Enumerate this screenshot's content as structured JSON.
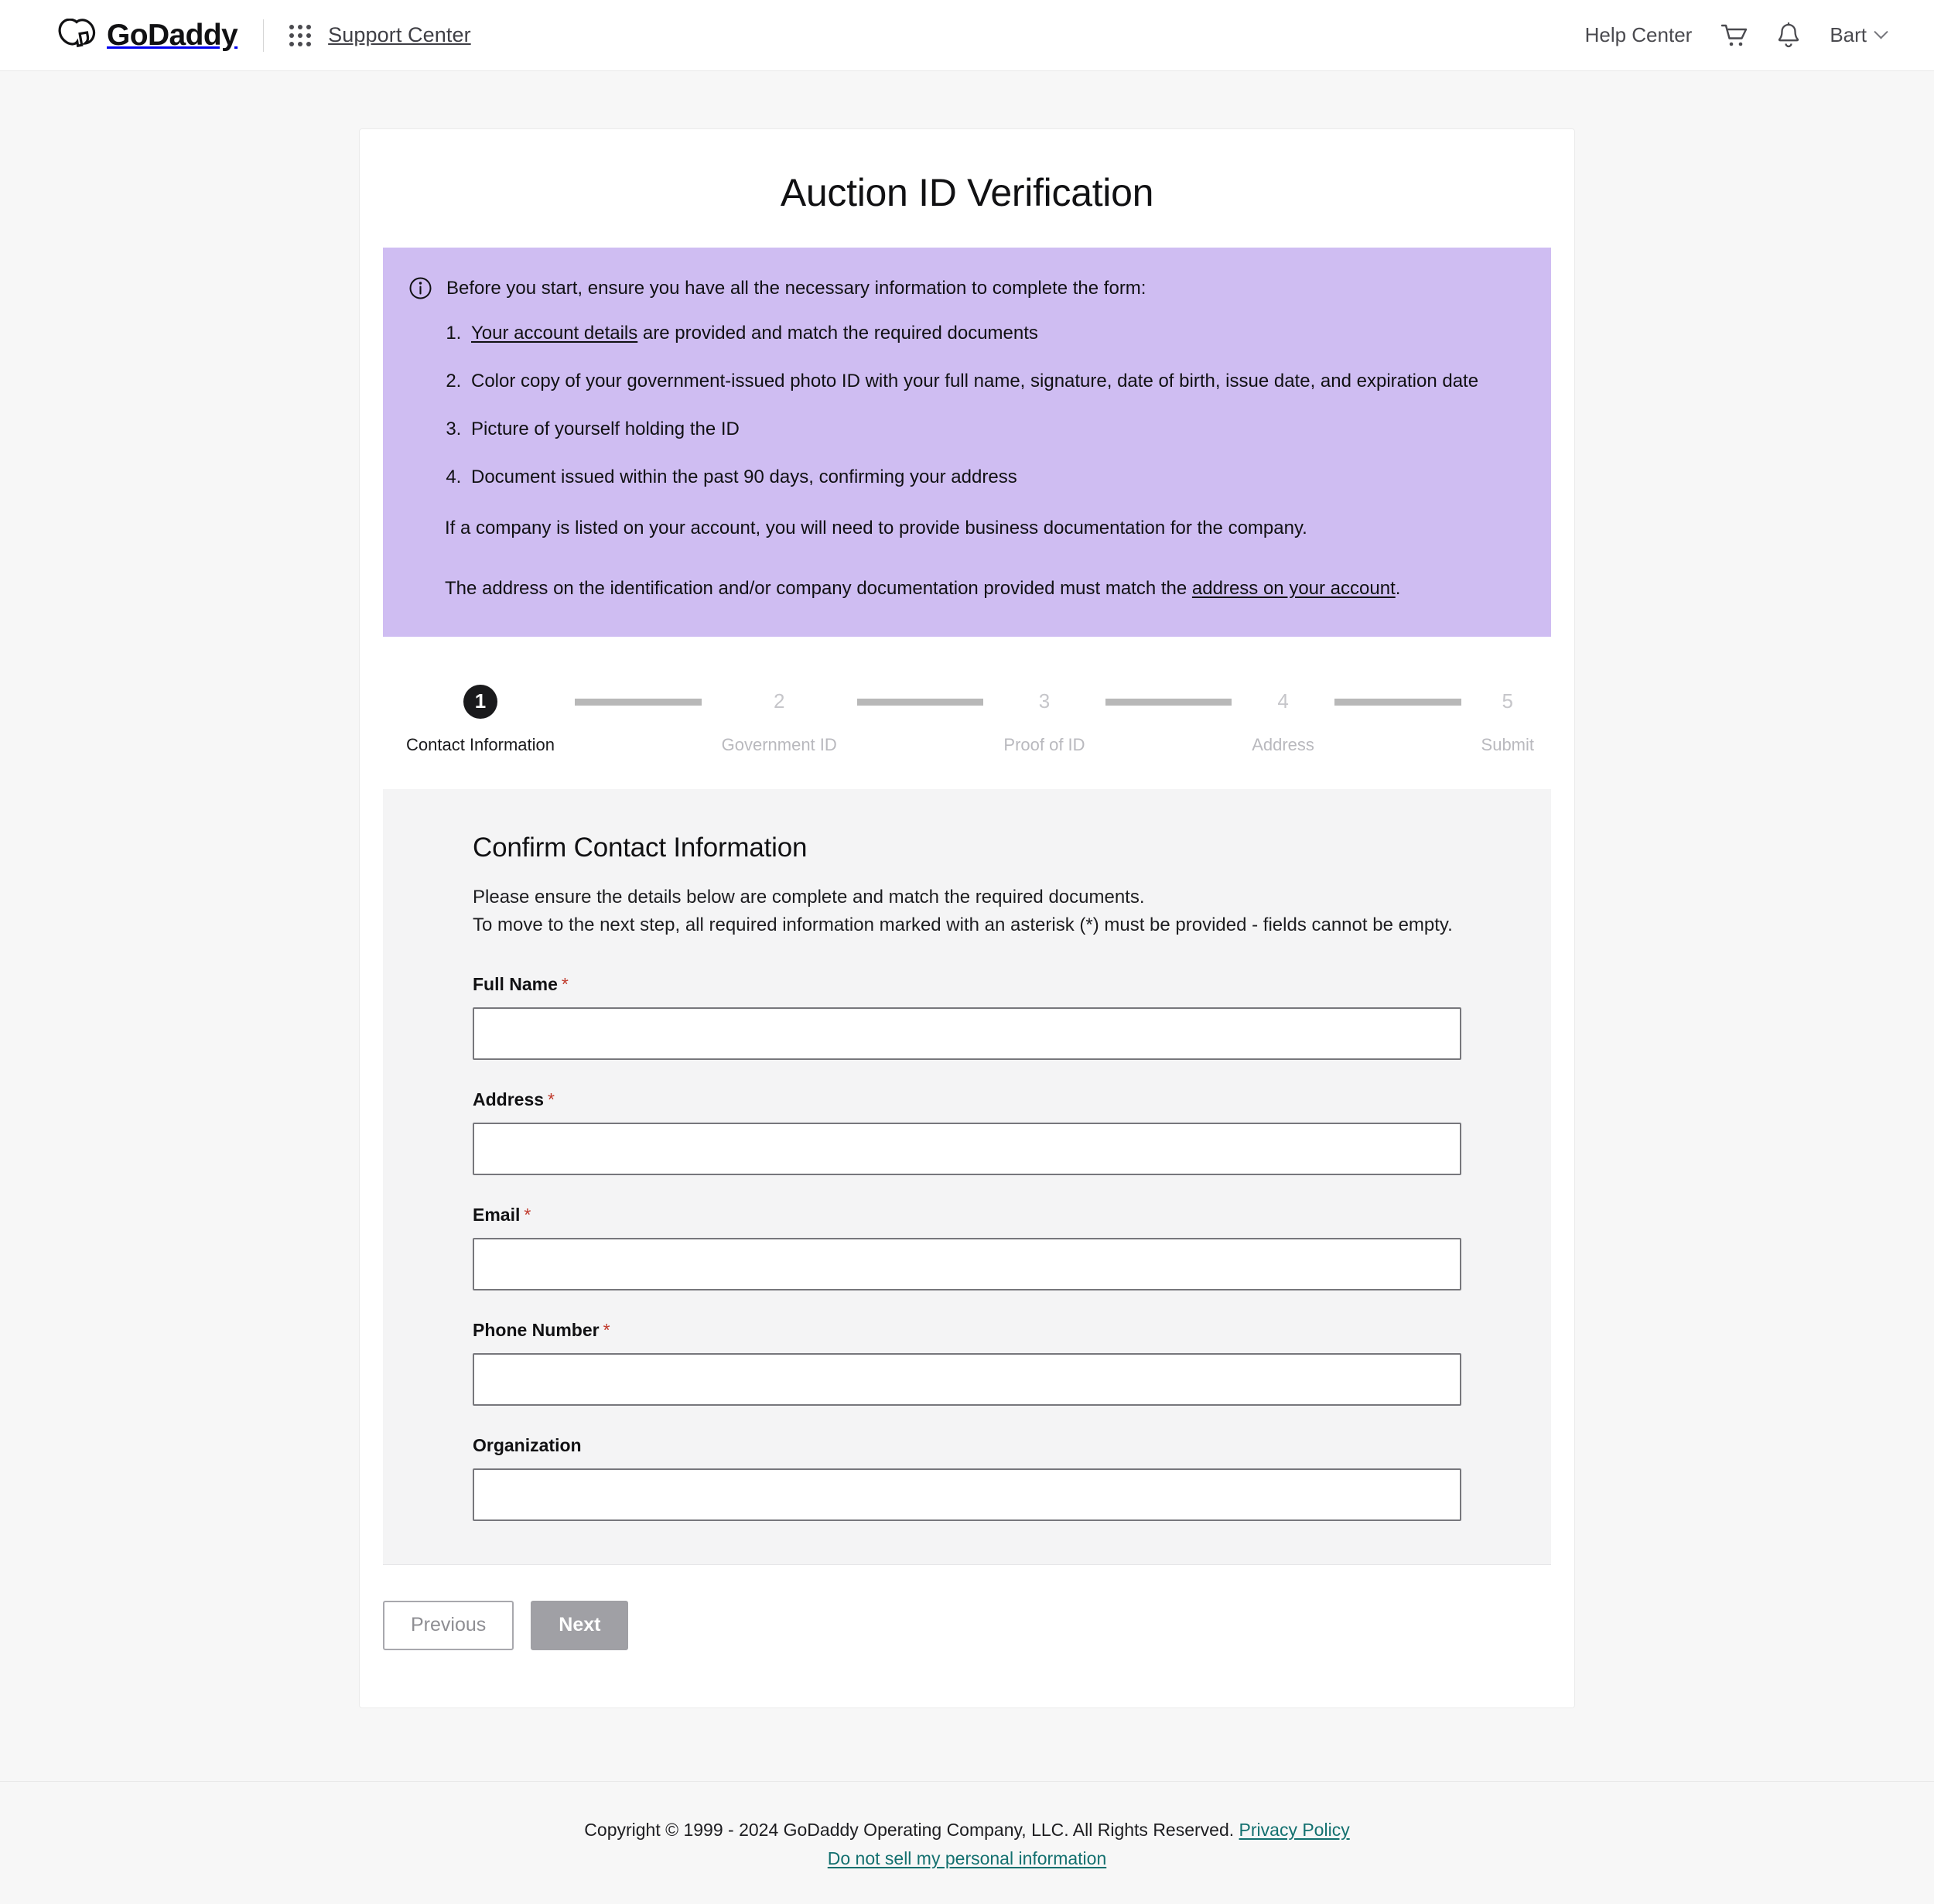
{
  "header": {
    "brand": "GoDaddy",
    "product": "Support Center",
    "help_center": "Help Center",
    "user_name": "Bart",
    "icons": {
      "logo": "godaddy-logo-icon",
      "apps_grid": "apps-grid-icon",
      "cart": "shopping-cart-icon",
      "bell": "notification-bell-icon",
      "chevron": "chevron-down-icon"
    }
  },
  "page": {
    "title": "Auction ID Verification"
  },
  "info_banner": {
    "icon": "info-circle-icon",
    "intro": "Before you start, ensure you have all the necessary information to complete the form:",
    "items": [
      {
        "link_text": "Your account details",
        "rest": " are provided and match the required documents"
      },
      {
        "link_text": "",
        "rest": "Color copy of your government-issued photo ID with your full name, signature, date of birth, issue date, and expiration date"
      },
      {
        "link_text": "",
        "rest": "Picture of yourself holding the ID"
      },
      {
        "link_text": "",
        "rest": "Document issued within the past 90 days, confirming your address"
      }
    ],
    "paragraph_company": "If a company is listed on your account, you will need to provide business documentation for the company.",
    "paragraph_address_prefix": "The address on the identification and/or company documentation provided must match the ",
    "paragraph_address_link": "address on your account",
    "paragraph_address_suffix": ".",
    "background_color": "#cfbdf2"
  },
  "stepper": {
    "current_step": 1,
    "steps": [
      {
        "number": "1",
        "label": "Contact Information",
        "state": "active"
      },
      {
        "number": "2",
        "label": "Government ID",
        "state": "inactive"
      },
      {
        "number": "3",
        "label": "Proof of ID",
        "state": "inactive"
      },
      {
        "number": "4",
        "label": "Address",
        "state": "inactive"
      },
      {
        "number": "5",
        "label": "Submit",
        "state": "inactive"
      }
    ]
  },
  "form": {
    "heading": "Confirm Contact Information",
    "description_line1": "Please ensure the details below are complete and match the required documents.",
    "description_line2": "To move to the next step, all required information marked with an asterisk (*) must be provided - fields cannot be empty.",
    "required_marker": "*",
    "fields": [
      {
        "label": "Full Name",
        "required": true,
        "value": "",
        "placeholder": ""
      },
      {
        "label": "Address",
        "required": true,
        "value": "",
        "placeholder": ""
      },
      {
        "label": "Email",
        "required": true,
        "value": "",
        "placeholder": ""
      },
      {
        "label": "Phone Number",
        "required": true,
        "value": "",
        "placeholder": ""
      },
      {
        "label": "Organization",
        "required": false,
        "value": "",
        "placeholder": ""
      }
    ]
  },
  "actions": {
    "previous_label": "Previous",
    "next_label": "Next"
  },
  "footer": {
    "copyright": "Copyright © 1999 - 2024 GoDaddy Operating Company, LLC. All Rights Reserved.",
    "privacy_policy": "Privacy Policy",
    "do_not_sell": "Do not sell my personal information",
    "link_color": "#13706f"
  }
}
